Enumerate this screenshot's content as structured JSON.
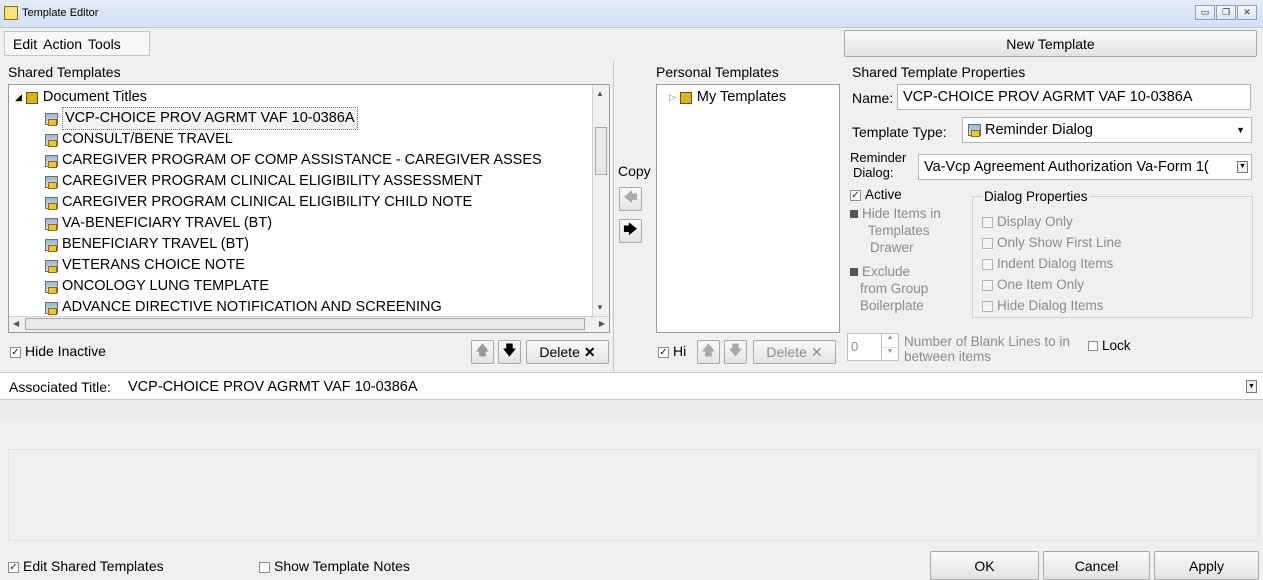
{
  "window": {
    "title": "Template Editor"
  },
  "menu": {
    "items": [
      "Edit",
      "Action",
      "Tools"
    ]
  },
  "new_template_button": "New Template",
  "shared": {
    "heading": "Shared Templates",
    "root": "Document Titles",
    "items": [
      "VCP-CHOICE PROV AGRMT VAF 10-0386A",
      "CONSULT/BENE TRAVEL",
      "CAREGIVER PROGRAM OF COMP ASSISTANCE - CAREGIVER ASSES",
      "CAREGIVER PROGRAM CLINICAL ELIGIBILITY ASSESSMENT",
      "CAREGIVER PROGRAM CLINICAL ELIGIBILITY CHILD NOTE",
      "VA-BENEFICIARY TRAVEL (BT)",
      "BENEFICIARY TRAVEL (BT)",
      "VETERANS CHOICE NOTE",
      "ONCOLOGY LUNG TEMPLATE",
      "ADVANCE DIRECTIVE NOTIFICATION AND SCREENING"
    ],
    "hide_inactive": "Hide Inactive",
    "delete": "Delete"
  },
  "copy": {
    "label": "Copy"
  },
  "personal": {
    "heading": "Personal Templates",
    "root": "My Templates",
    "hide_label": "Hi",
    "delete": "Delete"
  },
  "properties": {
    "heading": "Shared Template Properties",
    "name_label": "Name:",
    "name_value": "VCP-CHOICE PROV AGRMT VAF 10-0386A",
    "type_label": "Template Type:",
    "type_value": "Reminder Dialog",
    "reminder_label_1": "Reminder",
    "reminder_label_2": "Dialog:",
    "reminder_value": "Va-Vcp Agreement Authorization Va-Form 1(",
    "active": "Active",
    "hide_items_1": "Hide Items in",
    "hide_items_2": "Templates",
    "hide_items_3": "Drawer",
    "exclude_1": "Exclude",
    "exclude_2": "from Group",
    "exclude_3": "Boilerplate",
    "dialog_props": {
      "title": "Dialog Properties",
      "options": [
        "Display Only",
        "Only Show First Line",
        "Indent Dialog Items",
        "One Item Only",
        "Hide Dialog Items"
      ]
    },
    "blank_lines_value": "0",
    "blank_lines_1": "Number of Blank Lines to in",
    "blank_lines_2": "between items",
    "lock": "Lock"
  },
  "associated": {
    "label": "Associated Title:",
    "value": "VCP-CHOICE PROV AGRMT VAF 10-0386A"
  },
  "footer": {
    "edit_shared": "Edit Shared Templates",
    "show_notes": "Show Template Notes",
    "ok": "OK",
    "cancel": "Cancel",
    "apply": "Apply"
  }
}
